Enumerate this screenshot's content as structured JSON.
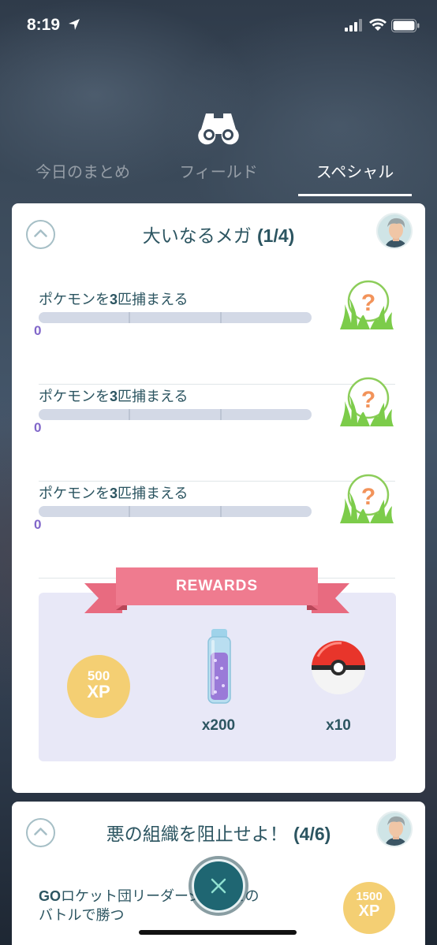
{
  "status_bar": {
    "time": "8:19"
  },
  "tabs": [
    {
      "label": "今日のまとめ",
      "active": false
    },
    {
      "label": "フィールド",
      "active": false
    },
    {
      "label": "スペシャル",
      "active": true
    }
  ],
  "card1": {
    "title": "大いなるメガ",
    "progress": "(1/4)",
    "tasks": [
      {
        "label_a": "ポケモンを",
        "label_num": "3",
        "label_b": "匹捕まえる",
        "count": "0",
        "progress_fraction": 0
      },
      {
        "label_a": "ポケモンを",
        "label_num": "3",
        "label_b": "匹捕まえる",
        "count": "0",
        "progress_fraction": 0
      },
      {
        "label_a": "ポケモンを",
        "label_num": "3",
        "label_b": "匹捕まえる",
        "count": "0",
        "progress_fraction": 0
      }
    ],
    "rewards": {
      "banner": "REWARDS",
      "xp_amount": "500",
      "xp_unit": "XP",
      "stardust_qty": "x200",
      "pokeball_qty": "x10"
    }
  },
  "card2": {
    "title": "悪の組織を阻止せよ！",
    "progress": "(4/6)",
    "task": {
      "label_prefix": "GO",
      "label_main": "ロケット団リーダー",
      "label_suffix": "シエロとの",
      "label_line2": "バトルで勝つ"
    },
    "reward": {
      "xp_amount": "1500",
      "xp_unit": "XP"
    }
  },
  "colors": {
    "accent_teal": "#2c5561",
    "progress_count": "#8066c9",
    "rewards_banner": "#ee7a8c",
    "xp_badge": "#f4cf73"
  }
}
